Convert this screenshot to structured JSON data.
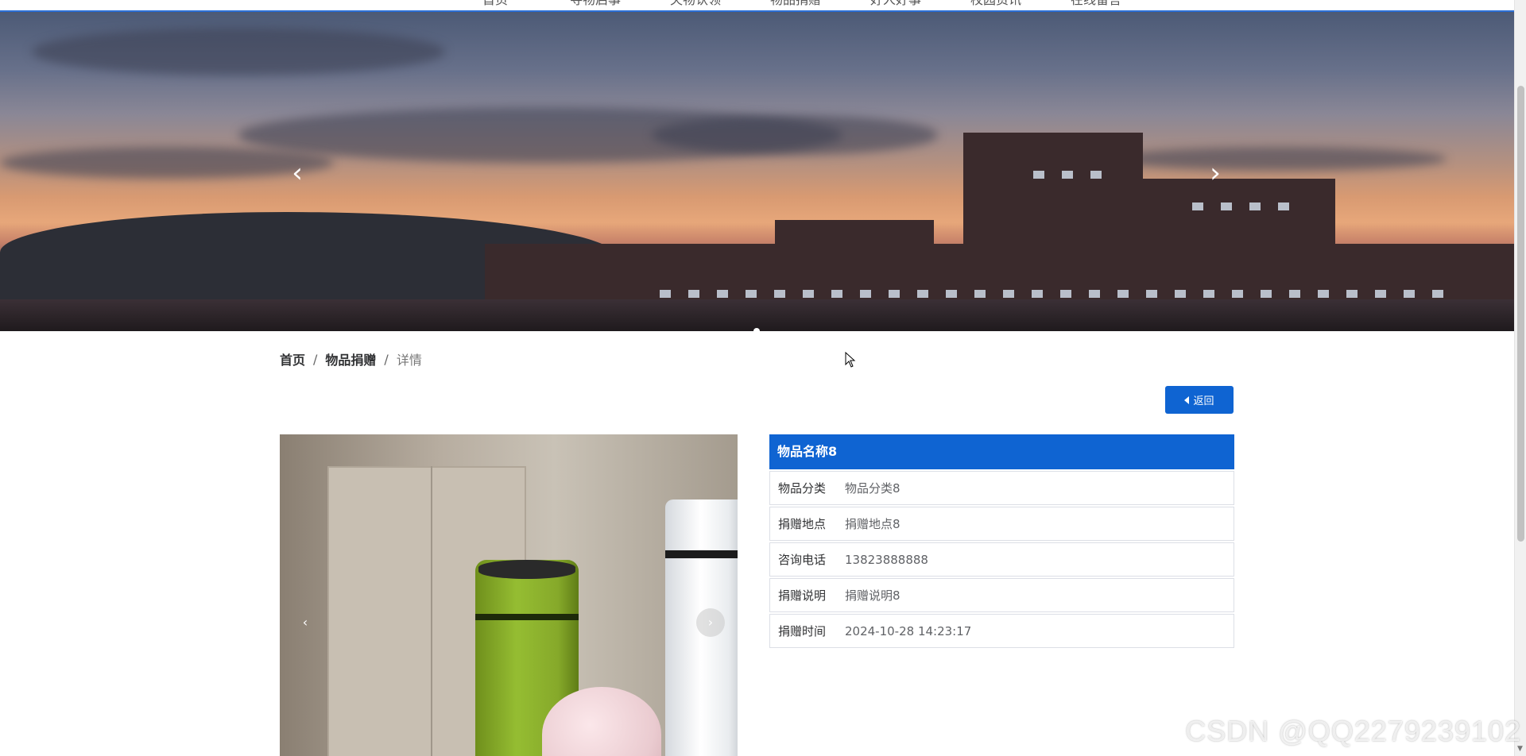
{
  "nav": {
    "items": [
      "首页",
      "寻物启事",
      "失物认领",
      "物品捐赠",
      "好人好事",
      "校园资讯",
      "在线留言"
    ]
  },
  "banner": {
    "prev_icon": "chevron-left-icon",
    "next_icon": "chevron-right-icon",
    "active_slide": 1,
    "slide_count": 1
  },
  "breadcrumb": {
    "home": "首页",
    "section": "物品捐赠",
    "current": "详情",
    "separator": "/"
  },
  "back_button": {
    "label": "返回",
    "icon": "caret-left-icon"
  },
  "carousel": {
    "prev_icon": "chevron-left-icon",
    "next_icon": "chevron-right-icon"
  },
  "detail": {
    "title": "物品名称8",
    "rows": [
      {
        "label": "物品分类",
        "value": "物品分类8"
      },
      {
        "label": "捐赠地点",
        "value": "捐赠地点8"
      },
      {
        "label": "咨询电话",
        "value": "13823888888"
      },
      {
        "label": "捐赠说明",
        "value": "捐赠说明8"
      },
      {
        "label": "捐赠时间",
        "value": "2024-10-28 14:23:17"
      }
    ]
  },
  "colors": {
    "primary": "#0f64d2",
    "border": "#dcdfe6"
  },
  "watermark": {
    "text": "CSDN @QQ2279239102"
  }
}
